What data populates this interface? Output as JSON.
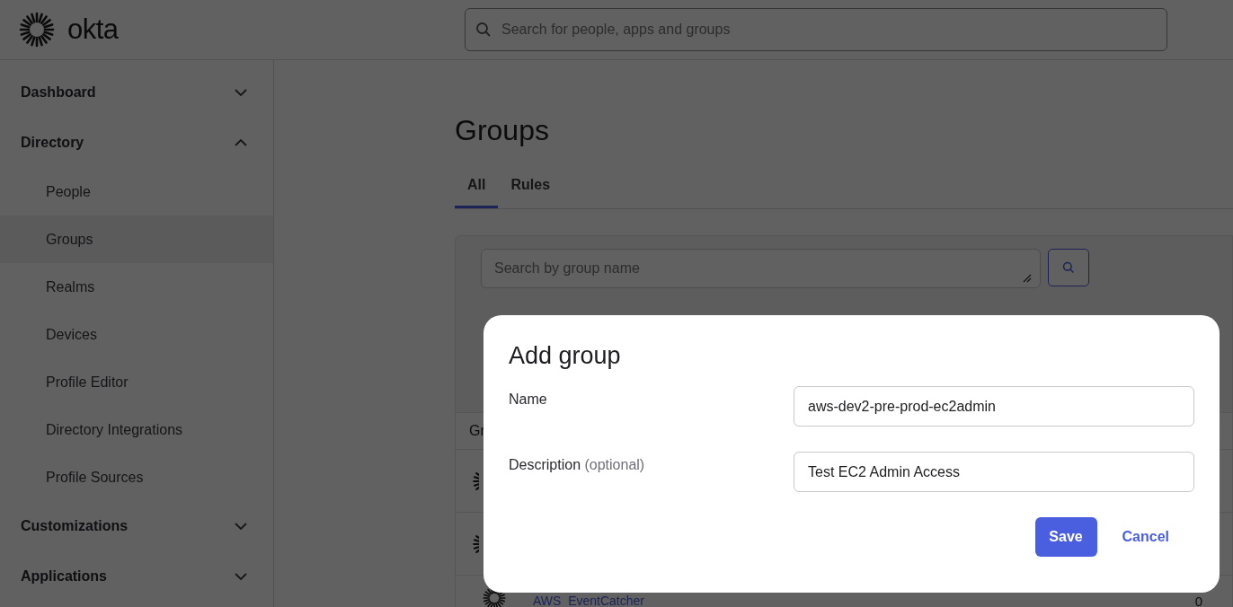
{
  "header": {
    "logo_text": "okta",
    "search": {
      "placeholder": "Search for people, apps and groups"
    }
  },
  "sidebar": {
    "sections": [
      {
        "label": "Dashboard",
        "expanded": false
      },
      {
        "label": "Directory",
        "expanded": true,
        "items": [
          {
            "label": "People",
            "selected": false
          },
          {
            "label": "Groups",
            "selected": true
          },
          {
            "label": "Realms",
            "selected": false
          },
          {
            "label": "Devices",
            "selected": false
          },
          {
            "label": "Profile Editor",
            "selected": false
          },
          {
            "label": "Directory Integrations",
            "selected": false
          },
          {
            "label": "Profile Sources",
            "selected": false
          }
        ]
      },
      {
        "label": "Customizations",
        "expanded": false
      },
      {
        "label": "Applications",
        "expanded": false
      }
    ]
  },
  "main": {
    "title": "Groups",
    "tabs": [
      {
        "label": "All",
        "selected": true
      },
      {
        "label": "Rules",
        "selected": false
      }
    ],
    "group_search": {
      "placeholder": "Search by group name"
    },
    "table": {
      "columns": [
        "Gr"
      ],
      "rows": [
        {
          "kind": "group"
        },
        {
          "kind": "group"
        },
        {
          "kind": "app",
          "name": "AWS_EventCatcher",
          "count": "0"
        }
      ]
    }
  },
  "dialog": {
    "title": "Add group",
    "fields": [
      {
        "label": "Name",
        "value": "aws-dev2-pre-prod-ec2admin"
      },
      {
        "label": "Description",
        "hint": "(optional)",
        "value": "Test EC2 Admin Access"
      }
    ],
    "save": "Save",
    "cancel": "Cancel"
  }
}
